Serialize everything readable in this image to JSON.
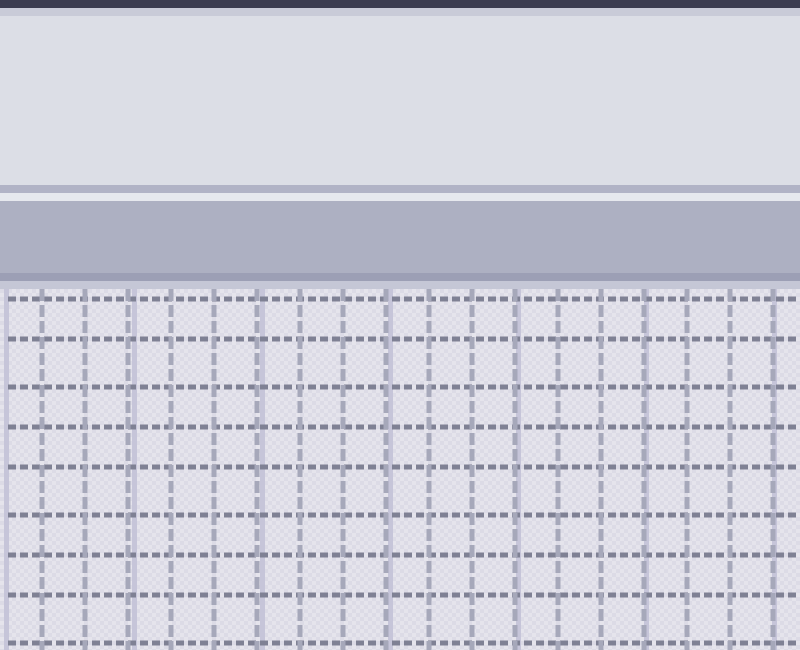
{
  "window": {
    "title": "",
    "colors": {
      "titlebar": "#3b3c50",
      "pane": "#dcdee6",
      "divider": "#b1b3c6",
      "toolbar": "#adb0c2",
      "grid_background": "#dcdbe6",
      "grid_major": "#7f8194",
      "grid_minor": "#a6a8ba",
      "grid_column_light": "#c6c5d9"
    }
  },
  "top_pane": {
    "content": ""
  },
  "toolbar": {
    "label": ""
  },
  "grid": {
    "style": "dashed-grid",
    "icon": "grid-icon"
  }
}
